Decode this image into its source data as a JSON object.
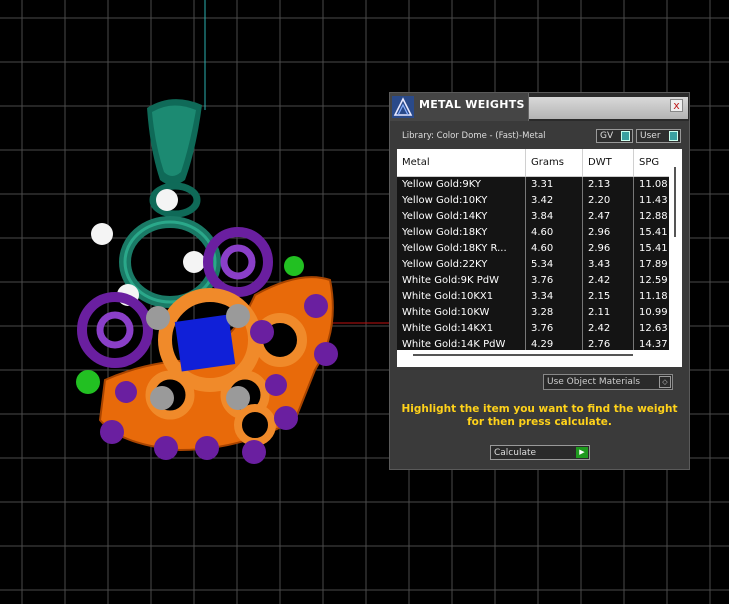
{
  "panel": {
    "title": "METAL WEIGHTS",
    "close_label": "x",
    "library_label": "Library: Color Dome - (Fast)-Metal",
    "toggles": [
      {
        "label": "GV"
      },
      {
        "label": "User"
      }
    ],
    "table": {
      "columns": [
        "Metal",
        "Grams",
        "DWT",
        "SPG"
      ],
      "rows": [
        [
          "Yellow Gold:9KY",
          "3.31",
          "2.13",
          "11.08"
        ],
        [
          "Yellow Gold:10KY",
          "3.42",
          "2.20",
          "11.43"
        ],
        [
          "Yellow Gold:14KY",
          "3.84",
          "2.47",
          "12.88"
        ],
        [
          "Yellow Gold:18KY",
          "4.60",
          "2.96",
          "15.41"
        ],
        [
          "Yellow Gold:18KY R...",
          "4.60",
          "2.96",
          "15.41"
        ],
        [
          "Yellow Gold:22KY",
          "5.34",
          "3.43",
          "17.89"
        ],
        [
          "White Gold:9K PdW",
          "3.76",
          "2.42",
          "12.59"
        ],
        [
          "White Gold:10KX1",
          "3.34",
          "2.15",
          "11.18"
        ],
        [
          "White Gold:10KW",
          "3.28",
          "2.11",
          "10.99"
        ],
        [
          "White Gold:14KX1",
          "3.76",
          "2.42",
          "12.63"
        ],
        [
          "White Gold:14K PdW",
          "4.29",
          "2.76",
          "14.37"
        ]
      ]
    },
    "material_dropdown": "Use Object Materials",
    "instruction": "Highlight the item you want to find the weight for then press calculate.",
    "calculate_label": "Calculate"
  },
  "colors": {
    "accent_yellow": "#ffd21a",
    "teal_metal": "#1a7a66",
    "purple_prongs": "#6a1fa0",
    "orange_setting": "#e86a0a",
    "center_stone": "#1020d8",
    "grid_line": "#555555"
  },
  "icons": [
    "app-logo-icon",
    "close-icon",
    "dropdown-arrow-icon",
    "play-arrow-icon"
  ]
}
